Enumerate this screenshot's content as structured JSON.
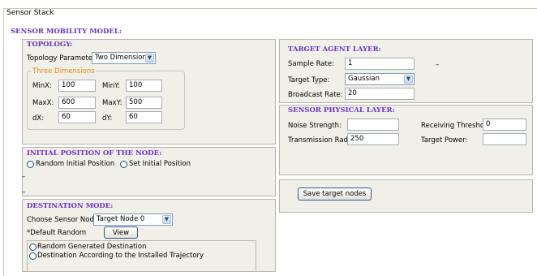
{
  "window": {
    "title": "Sensor Stack"
  },
  "header": {
    "title": "SENSOR MOBILITY MODEL:"
  },
  "topology": {
    "title": "TOPOLOGY:",
    "params_label": "Topology Parameters:",
    "params_value": "Two Dimensions",
    "group_title": "Three Dimensions",
    "minx_label": "MinX:",
    "minx_value": "100",
    "miny_label": "MinY:",
    "miny_value": "100",
    "maxx_label": "MaxX:",
    "maxx_value": "600",
    "maxy_label": "MaxY:",
    "maxy_value": "500",
    "dx_label": "dX:",
    "dx_value": "60",
    "dy_label": "dY:",
    "dy_value": "60"
  },
  "initial_position": {
    "title": "INITIAL POSITION OF THE NODE:",
    "random_label": "Random Initial Position",
    "set_label": "Set Initial Position",
    "marker1": "–",
    "marker2": "–"
  },
  "destination": {
    "title": "DESTINATION MODE:",
    "choose_label": "Choose Sensor Node:",
    "choose_value": "Target Node 0",
    "default_label": "*Default Random",
    "view_button": "View",
    "random_dest_label": "Random Generated Destination",
    "trajectory_label": "Destination According to the Installed Trajectory"
  },
  "target_agent": {
    "title": "TARGET AGENT LAYER:",
    "sample_rate_label": "Sample Rate:",
    "sample_rate_value": "1",
    "target_type_label": "Target Type:",
    "target_type_value": "Gaussian",
    "broadcast_rate_label": "Broadcast Rate:",
    "broadcast_rate_value": "20",
    "marker": "–"
  },
  "sensor_physical": {
    "title": "SENSOR PHYSICAL LAYER:",
    "noise_label": "Noise Strength:",
    "noise_value": "",
    "threshold_label": "Receiving Threshold:",
    "threshold_value": "0",
    "radius_label": "Transmission Radius:",
    "radius_value": "250",
    "power_label": "Target Power:",
    "power_value": ""
  },
  "save": {
    "label": "Save target nodes"
  }
}
